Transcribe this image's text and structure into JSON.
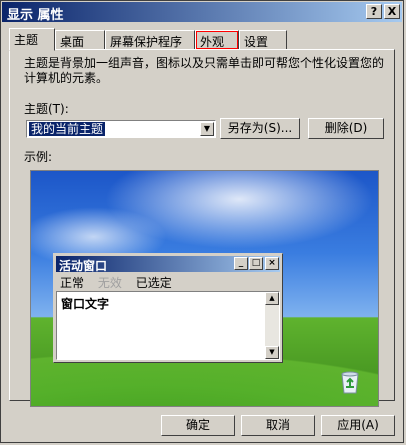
{
  "window": {
    "title": "显示 属性",
    "help_btn": "?",
    "close_btn": "X"
  },
  "tabs": [
    {
      "label": "主题",
      "active": true
    },
    {
      "label": "桌面"
    },
    {
      "label": "屏幕保护程序"
    },
    {
      "label": "外观",
      "highlighted": true
    },
    {
      "label": "设置"
    }
  ],
  "panel": {
    "description": "主题是背景加一组声音，图标以及只需单击即可帮您个性化设置您的计算机的元素。",
    "theme_label": "主题(T):",
    "theme_value": "我的当前主题",
    "save_as": "另存为(S)...",
    "delete": "删除(D)",
    "example_label": "示例:"
  },
  "preview_window": {
    "title": "活动窗口",
    "menu": {
      "normal": "正常",
      "disabled": "无效",
      "selected": "已选定"
    },
    "text": "窗口文字"
  },
  "footer": {
    "ok": "确定",
    "cancel": "取消",
    "apply": "应用(A)"
  },
  "icons": {
    "desktop_icon": "recycle-bin-icon"
  }
}
